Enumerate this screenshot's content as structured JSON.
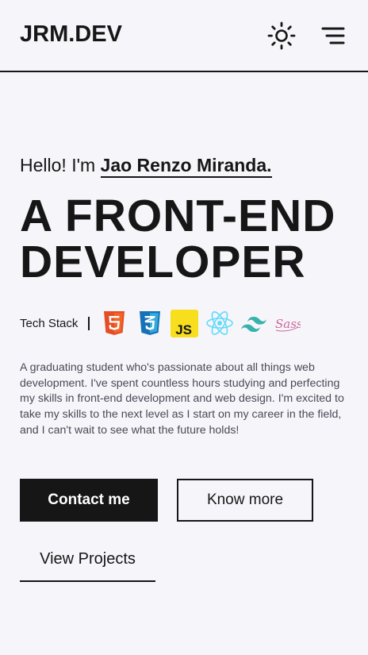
{
  "navbar": {
    "logo": "JRM.DEV",
    "theme_toggle_icon": "sun-icon",
    "menu_icon": "hamburger-menu-icon"
  },
  "hero": {
    "greeting_prefix": "Hello! I'm",
    "name": "Jao Renzo Miranda.",
    "headline_line1": "A FRONT-END",
    "headline_line2": "DEVELOPER",
    "tech_stack_label": "Tech Stack",
    "tech_icons": [
      "html5-icon",
      "css3-icon",
      "javascript-icon",
      "react-icon",
      "tailwind-icon",
      "sass-icon"
    ],
    "description": "A graduating student who's passionate about all things web development. I've spent countless hours studying and perfecting my skills in front-end development and web design. I'm excited to take my skills to the next level as I start on my career in the field, and I can't wait to see what the future holds!",
    "contact_button": "Contact me",
    "know_more_button": "Know more",
    "view_projects_link": "View Projects"
  },
  "colors": {
    "background": "#f6f5fa",
    "text": "#161616",
    "html5": "#e44d26",
    "css3": "#1572b6",
    "javascript": "#f7df1e",
    "react": "#61dafb",
    "tailwind": "#38b2ac",
    "sass": "#cd6799"
  }
}
